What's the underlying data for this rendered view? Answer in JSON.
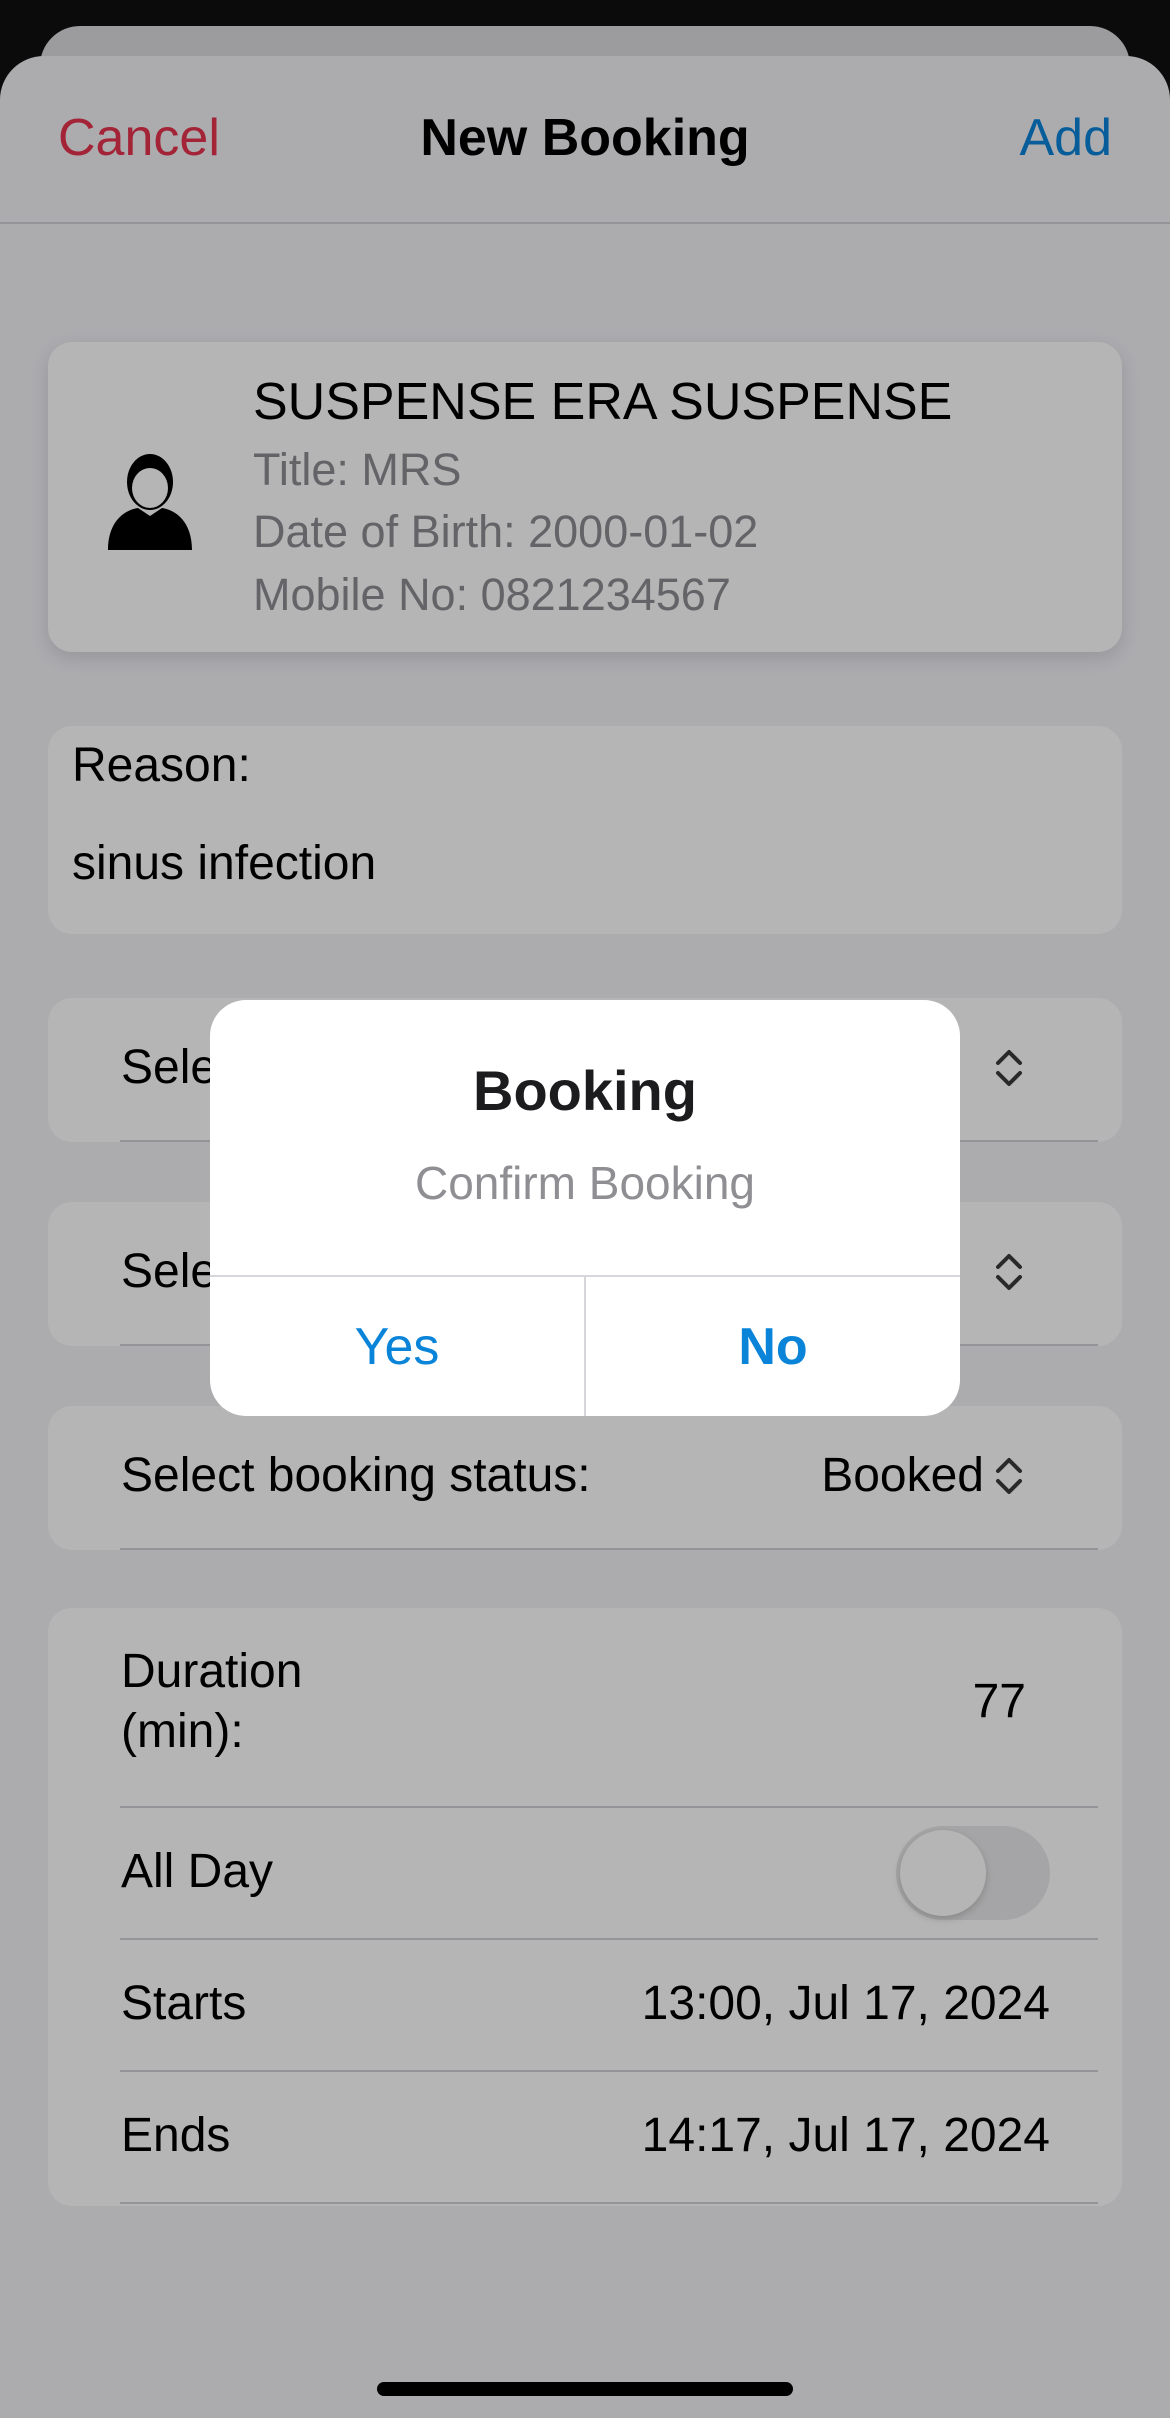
{
  "navbar": {
    "cancel_label": "Cancel",
    "title": "New Booking",
    "add_label": "Add"
  },
  "patient": {
    "name": "SUSPENSE ERA SUSPENSE",
    "title_line": "Title: MRS",
    "dob_line": "Date of Birth: 2000-01-02",
    "mobile_line": "Mobile No: 0821234567"
  },
  "reason": {
    "label": "Reason:",
    "value": "sinus infection"
  },
  "select_rows": [
    {
      "label": "Sele"
    },
    {
      "label": "Sele"
    },
    {
      "label": "Select booking status:",
      "value": "Booked"
    }
  ],
  "details": {
    "duration_label_line1": "Duration",
    "duration_label_line2": "(min):",
    "duration_value": "77",
    "all_day_label": "All Day",
    "all_day_on": false,
    "starts_label": "Starts",
    "starts_value": "13:00, Jul 17, 2024",
    "ends_label": "Ends",
    "ends_value": "14:17, Jul 17, 2024"
  },
  "alert": {
    "title": "Booking",
    "message": "Confirm Booking",
    "yes_label": "Yes",
    "no_label": "No"
  },
  "colors": {
    "accent": "#0a84d8",
    "destructive": "#e8344e",
    "background": "#f2f2f7"
  }
}
